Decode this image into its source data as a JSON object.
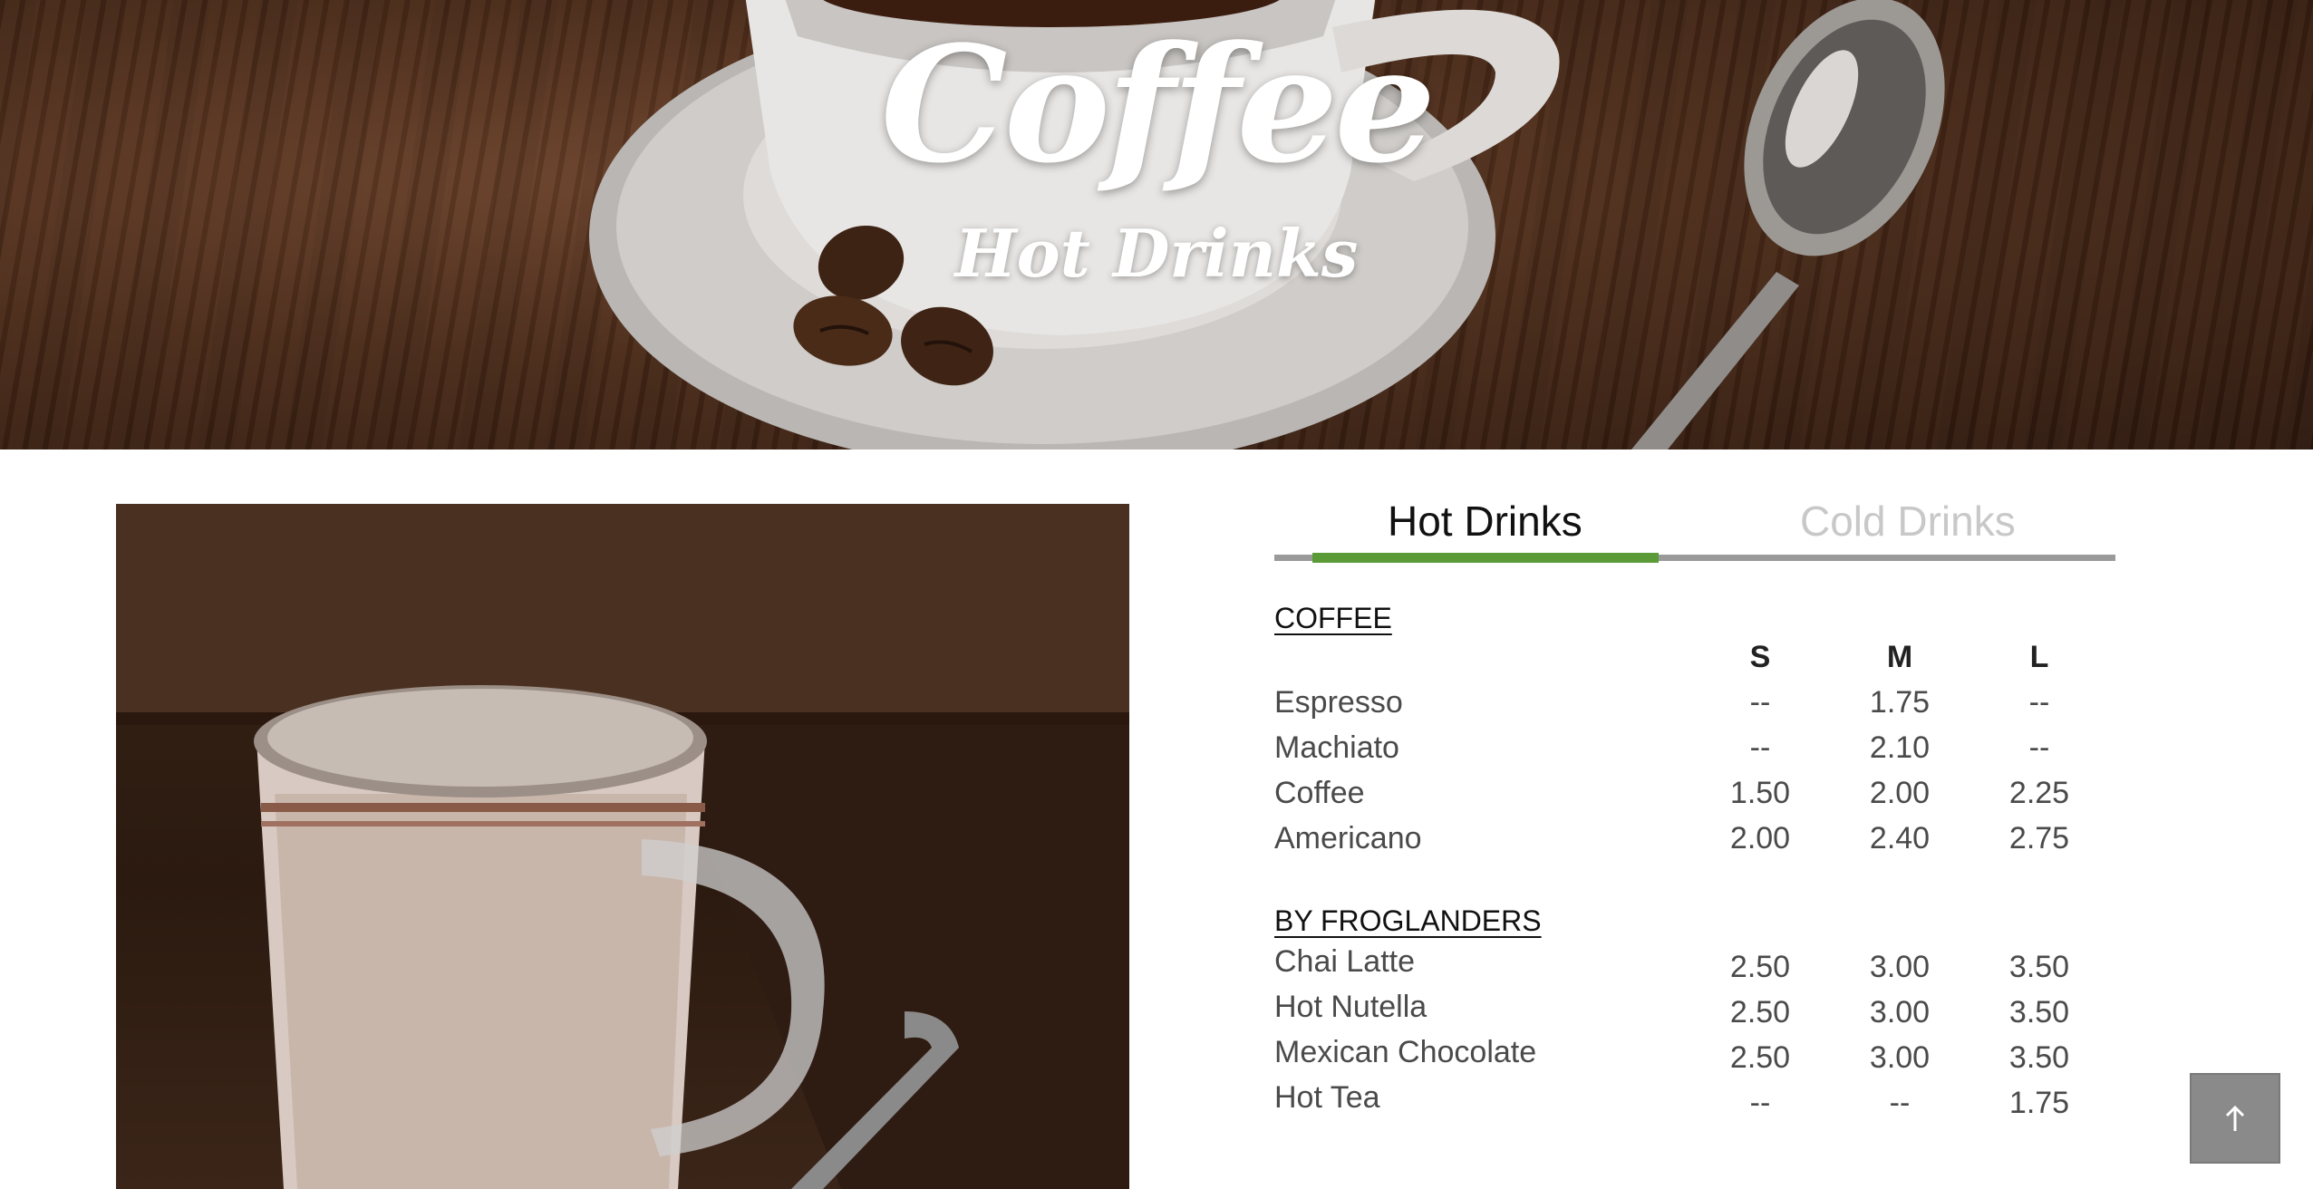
{
  "hero": {
    "title": "Coffee",
    "subtitle": "Hot Drinks"
  },
  "tabs": [
    {
      "label": "Hot Drinks",
      "active": true
    },
    {
      "label": "Cold Drinks",
      "active": false
    }
  ],
  "colors": {
    "accent": "#5a9a37",
    "tab_track": "#9a9a9a",
    "inactive_tab": "#c8c8c8",
    "back_to_top": "#8a8a8a"
  },
  "sizes": [
    "S",
    "M",
    "L"
  ],
  "sections": [
    {
      "title": "COFFEE",
      "items": [
        {
          "name": "Espresso",
          "s": "--",
          "m": "1.75",
          "l": "--"
        },
        {
          "name": "Machiato",
          "s": "--",
          "m": "2.10",
          "l": "--"
        },
        {
          "name": "Coffee",
          "s": "1.50",
          "m": "2.00",
          "l": "2.25"
        },
        {
          "name": "Americano",
          "s": "2.00",
          "m": "2.40",
          "l": "2.75"
        }
      ]
    },
    {
      "title": "BY FROGLANDERS",
      "items": [
        {
          "name": "Chai Latte",
          "s": "2.50",
          "m": "3.00",
          "l": "3.50"
        },
        {
          "name": "Hot Nutella",
          "s": "2.50",
          "m": "3.00",
          "l": "3.50"
        },
        {
          "name": "Mexican Chocolate",
          "s": "2.50",
          "m": "3.00",
          "l": "3.50"
        },
        {
          "name": "Hot Tea",
          "s": "--",
          "m": "--",
          "l": "1.75"
        }
      ]
    }
  ],
  "back_to_top_icon": "arrow-up-icon"
}
